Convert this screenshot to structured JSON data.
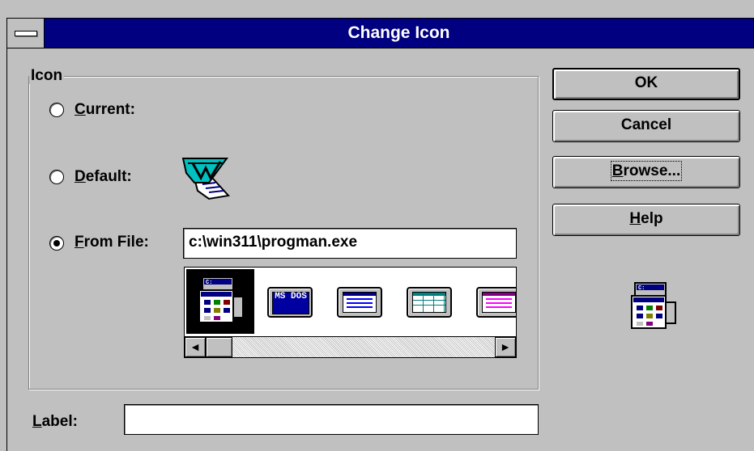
{
  "window": {
    "title": "Change Icon"
  },
  "icon_group": {
    "title": "Icon",
    "options": [
      {
        "label": "Current:",
        "accel": "C",
        "rest": "urrent:",
        "selected": false
      },
      {
        "label": "Default:",
        "accel": "D",
        "rest": "efault:",
        "selected": false
      },
      {
        "label": "From File:",
        "accel": "F",
        "rest": "rom File:",
        "selected": true
      }
    ],
    "file_path": "c:\\win311\\progman.exe",
    "icons": [
      {
        "name": "program-manager-icon",
        "selected": true
      },
      {
        "name": "ms-dos-icon",
        "text": "MS DOS"
      },
      {
        "name": "window-icon"
      },
      {
        "name": "grid-window-icon"
      },
      {
        "name": "list-window-icon"
      }
    ],
    "scroll_left": "◄",
    "scroll_right": "►"
  },
  "buttons": {
    "ok": "OK",
    "cancel": "Cancel",
    "browse": "Browse...",
    "browse_accel": "B",
    "browse_rest": "rowse...",
    "help": "Help",
    "help_accel": "H",
    "help_rest": "elp"
  },
  "label_field": {
    "label": "Label:",
    "accel": "L",
    "rest": "abel:",
    "value": ""
  },
  "colors": {
    "titlebar": "#000080",
    "face": "#c0c0c0",
    "highlight": "#ffffff",
    "shadow": "#808080"
  }
}
